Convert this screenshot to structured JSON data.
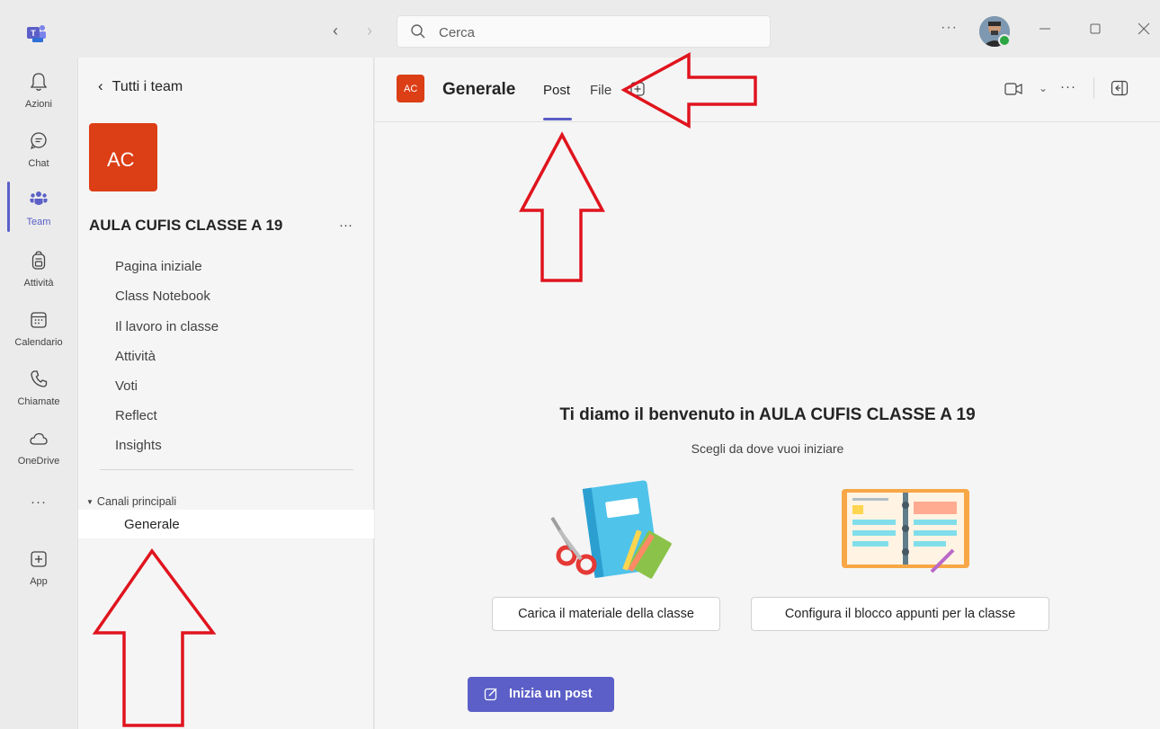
{
  "titlebar": {
    "search_placeholder": "Cerca",
    "more": "···"
  },
  "rail": {
    "items": [
      {
        "label": "Azioni",
        "icon": "bell-icon"
      },
      {
        "label": "Chat",
        "icon": "chat-icon"
      },
      {
        "label": "Team",
        "icon": "team-icon"
      },
      {
        "label": "Attività",
        "icon": "backpack-icon"
      },
      {
        "label": "Calendario",
        "icon": "calendar-icon"
      },
      {
        "label": "Chiamate",
        "icon": "phone-icon"
      },
      {
        "label": "OneDrive",
        "icon": "cloud-icon"
      },
      {
        "label": "App",
        "icon": "add-app-icon"
      }
    ],
    "more": "···"
  },
  "team_panel": {
    "back_label": "Tutti i team",
    "avatar_initials": "AC",
    "team_name": "AULA CUFIS CLASSE A 19",
    "more": "···",
    "menu": [
      "Pagina iniziale",
      "Class Notebook",
      "Il lavoro in classe",
      "Attività",
      "Voti",
      "Reflect",
      "Insights"
    ],
    "section_label": "Canali principali",
    "channel": "Generale"
  },
  "main": {
    "avatar_initials": "AC",
    "channel_title": "Generale",
    "tabs": [
      "Post",
      "File"
    ],
    "more": "···",
    "welcome_title": "Ti diamo il benvenuto in AULA CUFIS CLASSE A 19",
    "welcome_sub": "Scegli da dove vuoi iniziare",
    "btn_load": "Carica il materiale della classe",
    "btn_config": "Configura il blocco appunti per la classe",
    "btn_post": "Inizia un post"
  },
  "colors": {
    "accent": "#5b5fc7",
    "team_avatar": "#dc3e15",
    "annotation": "#e0141e"
  }
}
